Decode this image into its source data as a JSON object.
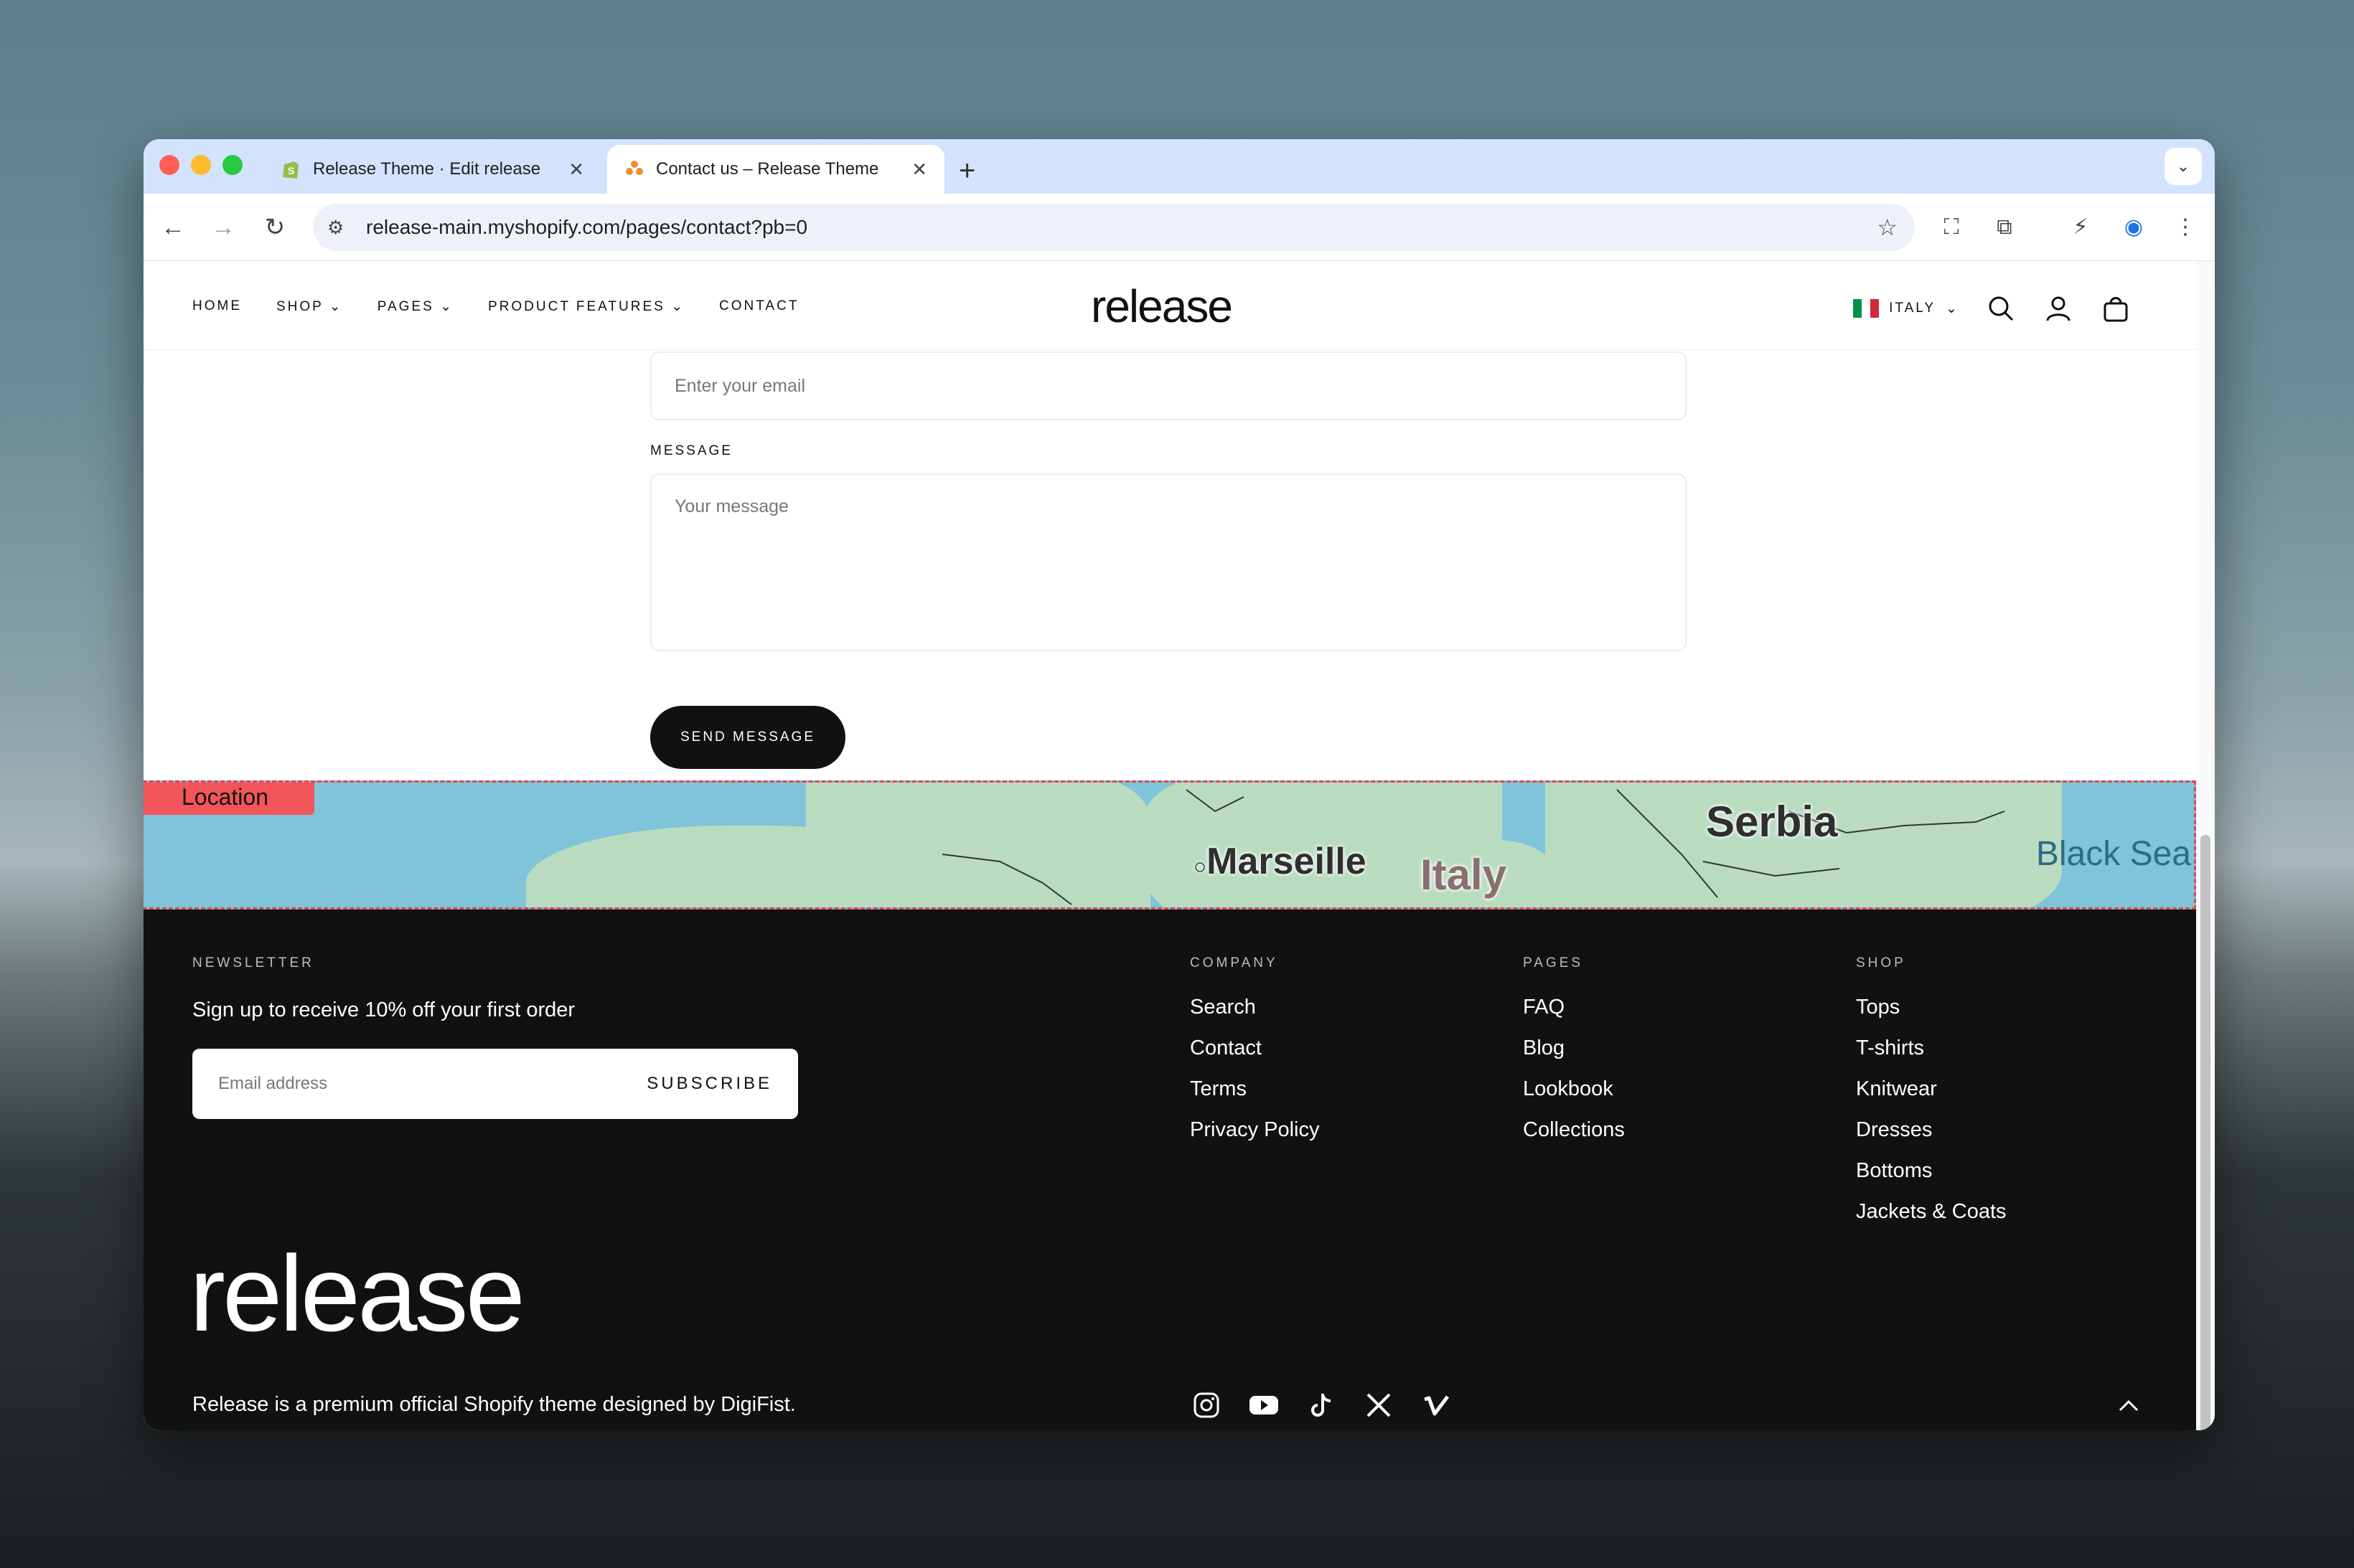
{
  "browser": {
    "tabs": [
      {
        "title": "Release Theme · Edit release",
        "close": "✕"
      },
      {
        "title": "Contact us – Release Theme",
        "close": "✕"
      }
    ],
    "new_tab": "+",
    "url": "release-main.myshopify.com/pages/contact?pb=0"
  },
  "header": {
    "nav": [
      "HOME",
      "SHOP",
      "PAGES",
      "PRODUCT FEATURES",
      "CONTACT"
    ],
    "logo": "release",
    "country": "ITALY"
  },
  "form": {
    "email_placeholder": "Enter your email",
    "message_label": "MESSAGE",
    "message_placeholder": "Your message",
    "send_label": "SEND MESSAGE"
  },
  "map": {
    "tag": "Location",
    "cities": [
      "Marseille",
      "Italy",
      "Serbia",
      "Black Sea"
    ]
  },
  "footer": {
    "newsletter": {
      "heading": "NEWSLETTER",
      "text": "Sign up to receive 10% off your first order",
      "placeholder": "Email address",
      "button": "SUBSCRIBE"
    },
    "company": {
      "heading": "COMPANY",
      "items": [
        "Search",
        "Contact",
        "Terms",
        "Privacy Policy"
      ]
    },
    "pages": {
      "heading": "PAGES",
      "items": [
        "FAQ",
        "Blog",
        "Lookbook",
        "Collections"
      ]
    },
    "shop": {
      "heading": "SHOP",
      "items": [
        "Tops",
        "T-shirts",
        "Knitwear",
        "Dresses",
        "Bottoms",
        "Jackets & Coats"
      ]
    },
    "logo": "release",
    "tagline": "Release is a premium official Shopify theme designed by DigiFist.",
    "socials": [
      "instagram-icon",
      "youtube-icon",
      "tiktok-icon",
      "x-icon",
      "vimeo-icon"
    ]
  },
  "colors": {
    "tabstrip": "#d3e3fd",
    "footer_bg": "#111111",
    "map_water": "#7fc4d8",
    "map_land": "#b9dcc0",
    "tag": "#f2555a"
  }
}
